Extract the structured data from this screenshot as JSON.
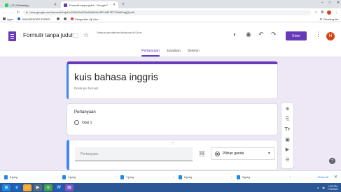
{
  "browser": {
    "tabs": [
      {
        "label": "(17) WhatsApp",
        "icon_color": "#25d366",
        "active": false
      },
      {
        "label": "Formulir tanpa judul - Google F",
        "icon_color": "#673ab7",
        "active": true
      }
    ],
    "new_tab": "+",
    "window_controls": [
      "–",
      "□",
      "✕"
    ],
    "url": "docs.google.com/forms/d/1wjzDx1WtNGuDWlnMW6hDzPEUMF2E7ONhEbIqjQ/edit",
    "bookmarks": [
      {
        "label": "Apps",
        "color": "#5f6368"
      },
      {
        "label": "UNIVERSITAS PGRIS…",
        "color": "#1565c0"
      },
      {
        "label": "",
        "color": "#5f6368"
      },
      {
        "label": "",
        "color": "#5f6368"
      },
      {
        "label": "Pengertian Uji Asu…",
        "color": "#e53935"
      }
    ],
    "reading_list": "Reading list"
  },
  "forms": {
    "doc_title": "Formulir tanpa judul",
    "save_note": "Semua perubahan disimpan di Drive",
    "send_label": "Kirim",
    "avatar_letter": "H",
    "tabs": [
      {
        "label": "Pertanyaan",
        "active": true
      },
      {
        "label": "Jawaban",
        "active": false
      },
      {
        "label": "Setelan",
        "active": false
      }
    ],
    "accent_color": "#673ab7"
  },
  "form": {
    "title": "kuis bahasa inggris",
    "description_placeholder": "Deskripsi formulir",
    "question1": {
      "label": "Pertanyaan",
      "option": "Opsi 1"
    },
    "question2": {
      "placeholder": "Pertanyaan",
      "type": "Pilihan ganda",
      "drag_handle": "⠿"
    }
  },
  "side_toolbar": [
    "add-question",
    "import-questions",
    "add-title",
    "add-image",
    "add-video",
    "add-section"
  ],
  "downloads": {
    "items": [
      "6.jpeg",
      "4.jpeg",
      "7.jpeg",
      "6.jpeg",
      "3.jpeg"
    ],
    "show_all": "Show all"
  },
  "taskbar": {
    "time": "1:52 PM",
    "date": "7/11/2021"
  }
}
